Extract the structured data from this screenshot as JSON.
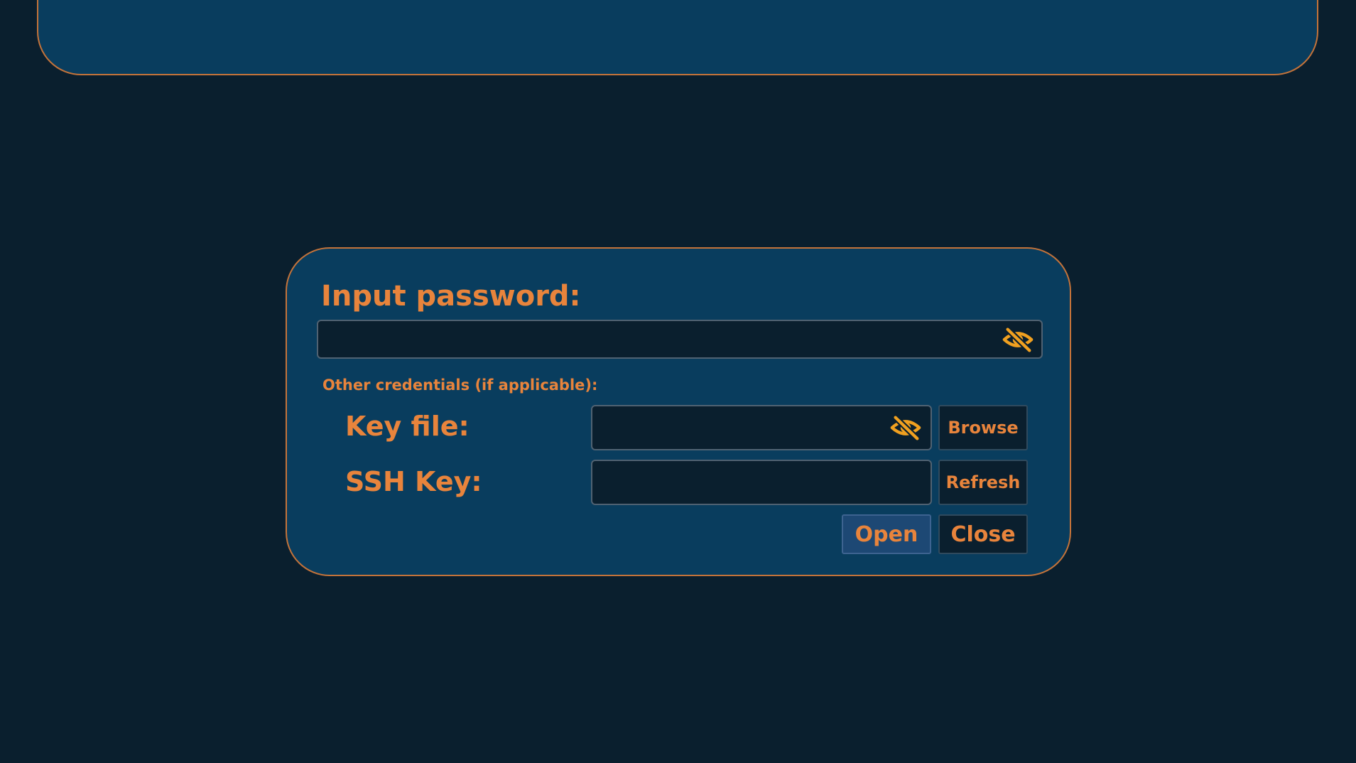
{
  "dialog": {
    "title": "Input password:",
    "password": {
      "value": "",
      "placeholder": ""
    },
    "other_credentials_label": "Other credentials (if applicable):",
    "key_file": {
      "label": "Key file:",
      "value": "",
      "browse_label": "Browse"
    },
    "ssh_key": {
      "label": "SSH Key:",
      "value": "",
      "refresh_label": "Refresh"
    },
    "open_label": "Open",
    "close_label": "Close"
  },
  "icons": {
    "visibility_toggle": "eye-slash-icon"
  },
  "colors": {
    "background": "#0a1f2e",
    "panel": "#093d5e",
    "accent": "#e8843c",
    "icon": "#f0a020",
    "open_button": "#1d4874"
  }
}
